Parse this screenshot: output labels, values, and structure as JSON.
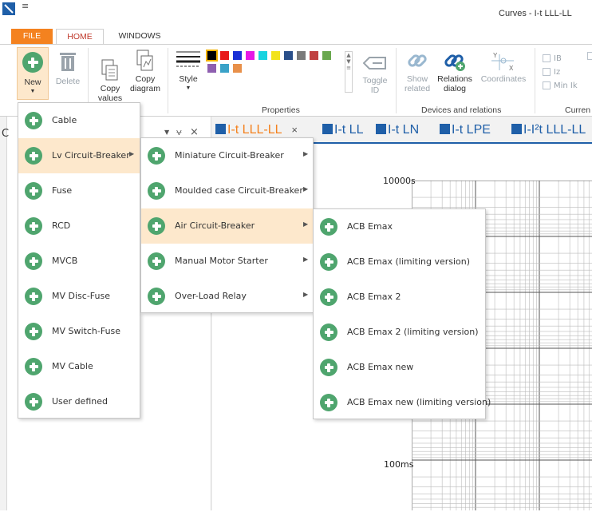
{
  "titlebar": {
    "quick_access": "≡",
    "title": "Curves - I-t LLL-LL"
  },
  "tabs": [
    "FILE",
    "HOME",
    "WINDOWS"
  ],
  "ribbon": {
    "new_label": "New",
    "delete_label": "Delete",
    "copy_values_label": "Copy\nvalues",
    "copy_diagram_label": "Copy\ndiagram",
    "style_label": "Style",
    "toggle_id_label": "Toggle\nID",
    "show_related_label": "Show\nrelated",
    "relations_dialog_label": "Relations\ndialog",
    "coordinates_label": "Coordinates",
    "checkboxes": [
      "IB",
      "Iz",
      "Min Ik"
    ],
    "group_clipboard": "t",
    "group_properties": "Properties",
    "group_devices": "Devices and relations",
    "group_current": "Curren",
    "swatches": [
      "#000000",
      "#e81818",
      "#1a2fd6",
      "#e619e6",
      "#17d3e0",
      "#f2e31b",
      "#2a4f8a",
      "#7a7a7a",
      "#c04040",
      "#6aa84f",
      "#8e5fb0",
      "#3aa2c8",
      "#e8904a"
    ]
  },
  "panel": {
    "title_partial": "C",
    "pin": "⩝",
    "close": "×"
  },
  "doc_tabs": [
    {
      "label": "I-t LLL-LL",
      "active": true
    },
    {
      "label": "I-t LL"
    },
    {
      "label": "I-t LN"
    },
    {
      "label": "I-t LPE"
    },
    {
      "label": "I-I²t LLL-LL"
    }
  ],
  "doc_tab_close": "×",
  "chart": {
    "y_labels": [
      "10000s",
      "100ms"
    ]
  },
  "menu1": [
    "Cable",
    "Lv Circuit-Breaker",
    "Fuse",
    "RCD",
    "MVCB",
    "MV Disc-Fuse",
    "MV Switch-Fuse",
    "MV Cable",
    "User defined"
  ],
  "menu2": [
    "Miniature Circuit-Breaker",
    "Moulded case Circuit-Breaker",
    "Air Circuit-Breaker",
    "Manual Motor Starter",
    "Over-Load Relay"
  ],
  "menu3": [
    "ACB Emax",
    "ACB Emax (limiting version)",
    "ACB Emax 2",
    "ACB Emax 2 (limiting version)",
    "ACB Emax new",
    "ACB Emax new (limiting version)"
  ],
  "submenu_arrow": "▶"
}
